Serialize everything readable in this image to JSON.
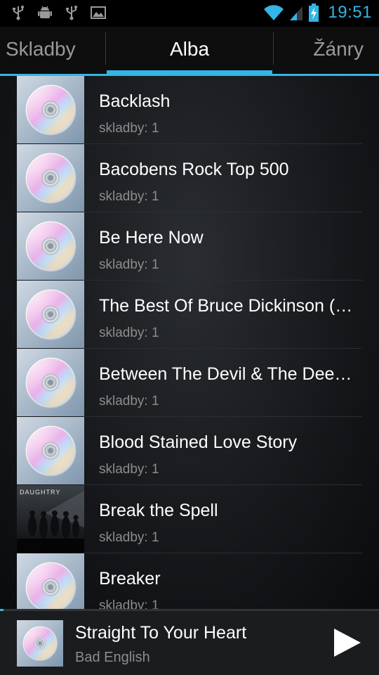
{
  "status_bar": {
    "time": "19:51",
    "icons_left": [
      "usb-icon",
      "android-debug-icon",
      "usb-icon",
      "image-icon"
    ],
    "icons_right": [
      "wifi-icon",
      "signal-icon",
      "battery-charging-icon"
    ],
    "accent_color": "#33b5e5"
  },
  "tabs": {
    "left": "Skladby",
    "center": "Alba",
    "right": "Žánry",
    "selected": "Alba"
  },
  "albums": [
    {
      "title": "Backlash",
      "tracks": "skladby: 1",
      "art": "cd-placeholder"
    },
    {
      "title": "Bacobens Rock Top 500",
      "tracks": "skladby: 1",
      "art": "cd-placeholder"
    },
    {
      "title": "Be Here Now",
      "tracks": "skladby: 1",
      "art": "cd-placeholder"
    },
    {
      "title": "The Best Of Bruce Dickinson (…",
      "tracks": "skladby: 1",
      "art": "cd-placeholder"
    },
    {
      "title": "Between The Devil & The Dee…",
      "tracks": "skladby: 1",
      "art": "cd-placeholder"
    },
    {
      "title": "Blood Stained Love Story",
      "tracks": "skladby: 1",
      "art": "cd-placeholder"
    },
    {
      "title": "Break the Spell",
      "tracks": "skladby: 1",
      "art": "daughtry-cover",
      "art_text": "DAUGHTRY"
    },
    {
      "title": "Breaker",
      "tracks": "skladby: 1",
      "art": "cd-placeholder"
    }
  ],
  "now_playing": {
    "title": "Straight To Your Heart",
    "artist": "Bad English",
    "progress": 0.01,
    "play_icon": "play-icon"
  }
}
